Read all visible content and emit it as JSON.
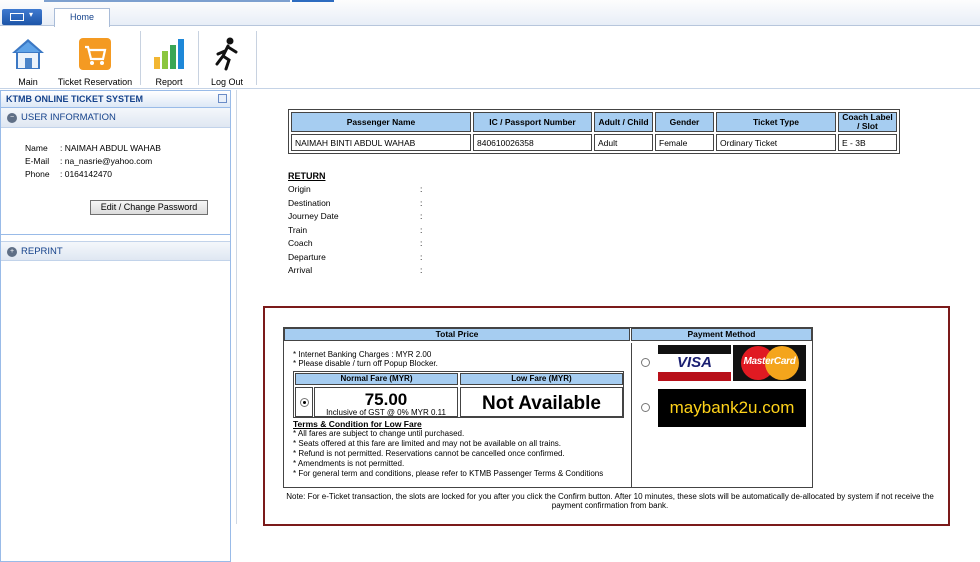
{
  "tabs": {
    "home": "Home"
  },
  "ribbon": {
    "main": "Main",
    "ticket_reservation": "Ticket Reservation",
    "report": "Report",
    "logout": "Log Out"
  },
  "sidebar": {
    "title": "KTMB ONLINE TICKET SYSTEM",
    "user_info_heading": "USER INFORMATION",
    "user": {
      "name_label": "Name",
      "name": ": NAIMAH ABDUL WAHAB",
      "email_label": "E-Mail",
      "email": ": na_nasrie@yahoo.com",
      "phone_label": "Phone",
      "phone": ": 0164142470"
    },
    "edit_password_button": "Edit / Change Password",
    "reprint_heading": "REPRINT"
  },
  "passenger_table": {
    "headers": [
      "Passenger Name",
      "IC / Passport Number",
      "Adult / Child",
      "Gender",
      "Ticket Type",
      "Coach Label / Slot"
    ],
    "rows": [
      [
        "NAIMAH BINTI ABDUL WAHAB",
        "840610026358",
        "Adult",
        "Female",
        "Ordinary Ticket",
        "E - 3B"
      ]
    ]
  },
  "return": {
    "title": "RETURN",
    "fields": [
      "Origin",
      "Destination",
      "Journey Date",
      "Train",
      "Coach",
      "Departure",
      "Arrival"
    ],
    "separator": ":"
  },
  "payment": {
    "total_price_heading": "Total Price",
    "payment_method_heading": "Payment Method",
    "note1": "* Internet Banking Charges : MYR 2.00",
    "note2": "* Please disable / turn off Popup Blocker.",
    "normal_fare_heading": "Normal Fare (MYR)",
    "low_fare_heading": "Low Fare (MYR)",
    "normal_fare_price": "75.00",
    "normal_fare_gst": "Inclusive of GST @ 0% MYR 0.11",
    "low_fare_value": "Not Available",
    "terms_title": "Terms & Condition for Low Fare",
    "terms": [
      "* All fares are subject to change until purchased.",
      "* Seats offered at this fare are limited and may not be available on all trains.",
      "* Refund is not permitted. Reservations cannot be cancelled once confirmed.",
      "* Amendments is not permitted.",
      "* For general term and conditions, please refer to KTMB Passenger Terms & Conditions"
    ],
    "visa_label": "VISA",
    "mastercard_label": "MasterCard",
    "maybank_label": "maybank2u.com",
    "footer_note": "Note: For e-Ticket transaction, the slots are locked for you after you click the Confirm button. After 10 minutes, these slots will be automatically de-allocated by system if not receive the payment confirmation from bank."
  }
}
